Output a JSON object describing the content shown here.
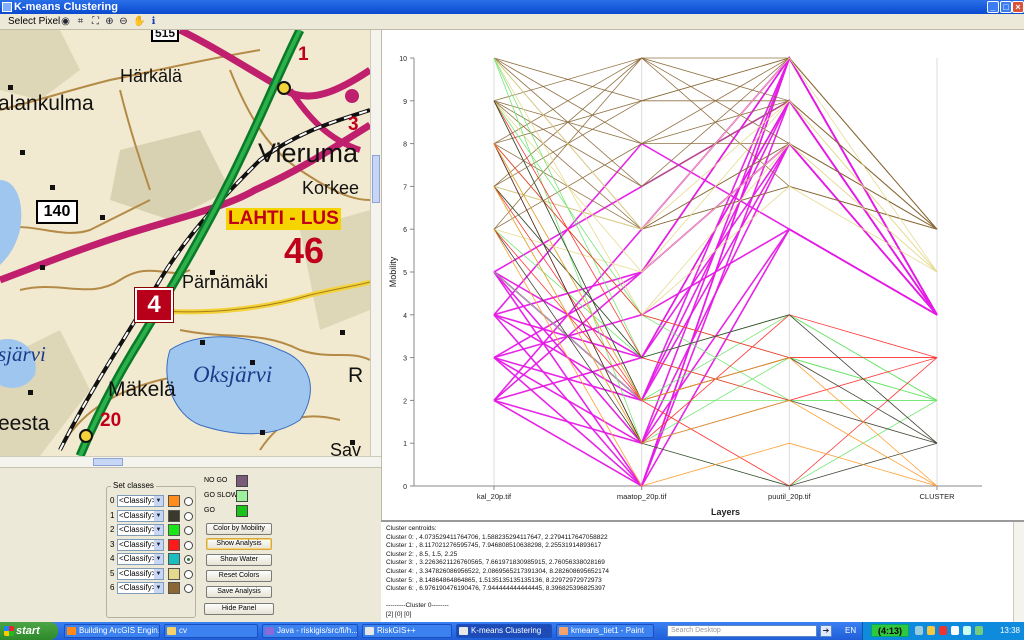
{
  "window": {
    "title": "K-means Clustering",
    "minimize": "_",
    "maximize": "□",
    "close": "×"
  },
  "toolbar": {
    "select_pixel": "Select Pixel",
    "icons": [
      "globe-icon",
      "full-extent-icon",
      "fixed-zoom-icon",
      "zoom-in-icon",
      "zoom-out-icon",
      "pan-hand-icon",
      "info-icon"
    ]
  },
  "map": {
    "labels": {
      "harkala": "Härkälä",
      "alankulma": "alankulma",
      "vieruma": "Vieruma",
      "korkee": "Korkee",
      "lahti": "LAHTI - LUS",
      "n46": "46",
      "parnamaki": "Pärnämäki",
      "sjarvi": "sjärvi",
      "makela": "Mäkelä",
      "oksjarvi": "Oksjärvi",
      "eesta": "eesta",
      "r": "R",
      "sav": "Sav",
      "n1": "1",
      "n3": "3",
      "n20": "20",
      "n515": "515",
      "shield140": "140",
      "shield4": "4"
    }
  },
  "set_classes": {
    "title": "Set classes",
    "rows": [
      {
        "num": "0",
        "value": "<Classify>",
        "color": "#ff8c1a",
        "selected": false
      },
      {
        "num": "1",
        "value": "<Classify>",
        "color": "#3a3a2c",
        "selected": false
      },
      {
        "num": "2",
        "value": "<Classify>",
        "color": "#19e619",
        "selected": false
      },
      {
        "num": "3",
        "value": "<Classify>",
        "color": "#ff1a1a",
        "selected": false
      },
      {
        "num": "4",
        "value": "<Classify>",
        "color": "#19bfbf",
        "selected": true
      },
      {
        "num": "5",
        "value": "<Classify>",
        "color": "#e6d98c",
        "selected": false
      },
      {
        "num": "6",
        "value": "<Classify>",
        "color": "#8c6633",
        "selected": false
      }
    ]
  },
  "mobility_legend": [
    {
      "label": "NO GO",
      "color": "#7a5a7a"
    },
    {
      "label": "GO SLOW",
      "color": "#9ef29e"
    },
    {
      "label": "GO",
      "color": "#19c319"
    }
  ],
  "buttons": {
    "color_by_mobility": "Color by Mobility",
    "show_analysis": "Show Analysis",
    "show_water": "Show Water",
    "reset_colors": "Reset Colors",
    "save_analysis": "Save Analysis",
    "hide_panel": "Hide Panel"
  },
  "chart_data": {
    "type": "line",
    "title": "",
    "xlabel": "Layers",
    "ylabel": "Mobility",
    "categories": [
      "kal_20p.tif",
      "maatop_20p.tif",
      "puutil_20p.tif",
      "CLUSTER"
    ],
    "ylim": [
      0,
      10
    ],
    "yticks": [
      0,
      1,
      2,
      3,
      4,
      5,
      6,
      7,
      8,
      9,
      10
    ],
    "grid": "vertical at each layer",
    "legend": "none",
    "series": [
      {
        "color": "#e619e6",
        "width": 1.6,
        "lines": [
          [
            5,
            0,
            10,
            4
          ],
          [
            4,
            3,
            9,
            4
          ],
          [
            3,
            2,
            8,
            4
          ],
          [
            2,
            1,
            6,
            4
          ],
          [
            4,
            5,
            10,
            4
          ],
          [
            5,
            3,
            8,
            4
          ],
          [
            2,
            3,
            9,
            4
          ],
          [
            3,
            5,
            10,
            4
          ],
          [
            4,
            0,
            6,
            4
          ],
          [
            2,
            6,
            10,
            4
          ],
          [
            5,
            7,
            9,
            4
          ],
          [
            3,
            1,
            8,
            4
          ],
          [
            4,
            2,
            10,
            4
          ],
          [
            2,
            0,
            9,
            4
          ],
          [
            3,
            4,
            6,
            4
          ],
          [
            5,
            2,
            9,
            4
          ],
          [
            4,
            8,
            6,
            4
          ],
          [
            3,
            0,
            10,
            4
          ],
          [
            2,
            5,
            8,
            4
          ],
          [
            5,
            1,
            10,
            4
          ]
        ]
      },
      {
        "color": "#8b6a3a",
        "width": 0.8,
        "lines": [
          [
            10,
            9,
            9,
            6
          ],
          [
            9,
            8,
            10,
            6
          ],
          [
            8,
            10,
            7,
            6
          ],
          [
            7,
            6,
            8,
            6
          ],
          [
            10,
            7,
            10,
            6
          ],
          [
            9,
            10,
            8,
            6
          ],
          [
            8,
            9,
            10,
            6
          ],
          [
            6,
            8,
            9,
            6
          ],
          [
            10,
            6,
            7,
            6
          ],
          [
            7,
            9,
            10,
            6
          ],
          [
            9,
            7,
            9,
            6
          ],
          [
            8,
            6,
            8,
            6
          ],
          [
            6,
            10,
            10,
            6
          ],
          [
            10,
            8,
            8,
            6
          ],
          [
            7,
            10,
            9,
            6
          ],
          [
            9,
            6,
            7,
            6
          ]
        ]
      },
      {
        "color": "#e6d98c",
        "width": 0.8,
        "lines": [
          [
            10,
            6,
            9,
            5
          ],
          [
            9,
            5,
            8,
            5
          ],
          [
            7,
            6,
            10,
            5
          ],
          [
            8,
            4,
            7,
            5
          ],
          [
            6,
            5,
            9,
            5
          ],
          [
            10,
            4,
            8,
            5
          ]
        ]
      },
      {
        "color": "#6ee66e",
        "width": 0.8,
        "lines": [
          [
            10,
            3,
            4,
            2
          ],
          [
            9,
            2,
            3,
            2
          ],
          [
            8,
            4,
            2,
            2
          ],
          [
            7,
            1,
            3,
            2
          ],
          [
            6,
            3,
            4,
            2
          ],
          [
            5,
            2,
            2,
            2
          ],
          [
            10,
            1,
            0,
            2
          ],
          [
            8,
            2,
            4,
            2
          ],
          [
            9,
            4,
            3,
            2
          ],
          [
            7,
            3,
            2,
            2
          ]
        ]
      },
      {
        "color": "#ff2a2a",
        "width": 0.8,
        "lines": [
          [
            8,
            1,
            4,
            3
          ],
          [
            7,
            2,
            3,
            3
          ],
          [
            9,
            3,
            2,
            3
          ],
          [
            6,
            2,
            0,
            3
          ],
          [
            8,
            4,
            3,
            3
          ]
        ]
      },
      {
        "color": "#3a3a2c",
        "width": 0.8,
        "lines": [
          [
            9,
            2,
            3,
            1
          ],
          [
            8,
            1,
            2,
            1
          ],
          [
            7,
            3,
            4,
            1
          ],
          [
            6,
            1,
            0,
            1
          ]
        ]
      },
      {
        "color": "#ff9a2a",
        "width": 0.8,
        "lines": [
          [
            7,
            1,
            2,
            0
          ],
          [
            8,
            2,
            3,
            0
          ],
          [
            6,
            0,
            1,
            0
          ]
        ]
      }
    ]
  },
  "output": {
    "lines": [
      "Cluster centroids:",
      "Cluster 0: , 4.07352941176470​6, 1.588235294117647, 2.27941176470588​22",
      "Cluster 1: , 8.117021276595745, 7.946808510638298, 2.25531914893617",
      "Cluster 2: , 8.5, 1.5, 2.25",
      "Cluster 3: , 3.2263621126760565, 7.661971830985915, 2.76056338028169",
      "Cluster 4: , 3.347826086956522, 2.0869565217391304, 8.28260869565217​4",
      "Cluster 5: , 8.14864864864865, 1.5135135135135136, 8.22972972972973",
      "Cluster 6: , 6.976190476190476, 7.944444444444445, 8.396825396825397",
      "",
      "---------Cluster 0--------",
      "[2] [0] [0]"
    ]
  },
  "taskbar": {
    "start": "start",
    "items": [
      {
        "label": "Building ArcGIS Engin...",
        "color": "#ff8a1a",
        "active": false
      },
      {
        "label": "cv",
        "color": "#f5d36b",
        "active": false
      },
      {
        "label": "Java - riskigis/src/fi/h...",
        "color": "#8a6ad8",
        "active": false
      },
      {
        "label": "RiskGIS++",
        "color": "#e8e8e8",
        "active": false
      },
      {
        "label": "K-means Clustering",
        "color": "#e8e8e8",
        "active": true
      },
      {
        "label": "kmeans_tiet1 - Paint",
        "color": "#f5a36b",
        "active": false
      }
    ],
    "search_placeholder": "Search Desktop",
    "language": "EN",
    "counter": "(4:13)",
    "clock": "13:38"
  }
}
